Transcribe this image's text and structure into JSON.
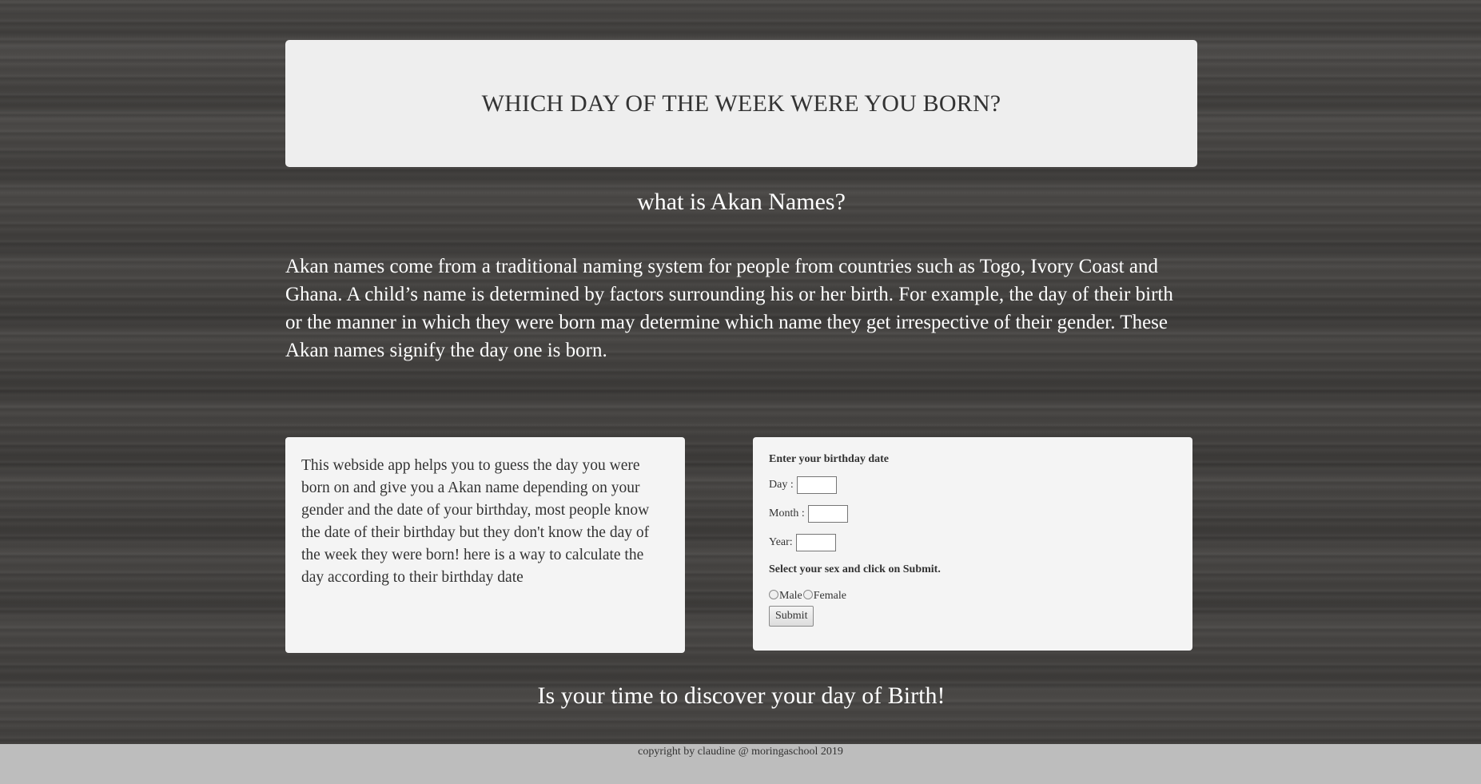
{
  "header": {
    "title": "WHICH DAY OF THE WEEK WERE YOU BORN?"
  },
  "intro": {
    "heading": "what is Akan Names?",
    "text": "Akan names come from a traditional naming system for people from countries such as Togo, Ivory Coast and Ghana. A child’s name is determined by factors surrounding his or her birth. For example, the day of their birth or the manner in which they were born may determine which name they get irrespective of their gender. These Akan names signify the day one is born."
  },
  "info": {
    "text": "This webside app helps you to guess the day you were born on and give you a Akan name depending on your gender and the date of your birthday, most people know the date of their birthday but they don't know the day of the week they were born! here is a way to calculate the day according to their birthday date"
  },
  "form": {
    "birthday_label": "Enter your birthday date",
    "day_label": "Day :",
    "day_value": "",
    "month_label": "Month :",
    "month_value": "",
    "year_label": "Year:",
    "year_value": "",
    "sex_label": "Select your sex and click on Submit.",
    "male_label": "Male",
    "female_label": "Female",
    "submit_label": "Submit"
  },
  "discover": {
    "text": "Is your time to discover your day of Birth!"
  },
  "footer": {
    "text": "copyright by claudine @ moringaschool 2019"
  },
  "colors": {
    "background": "#464442",
    "panel": "#eeeeee",
    "footer": "#bdbdbd",
    "text_dark": "#333333",
    "text_light": "#ffffff"
  }
}
